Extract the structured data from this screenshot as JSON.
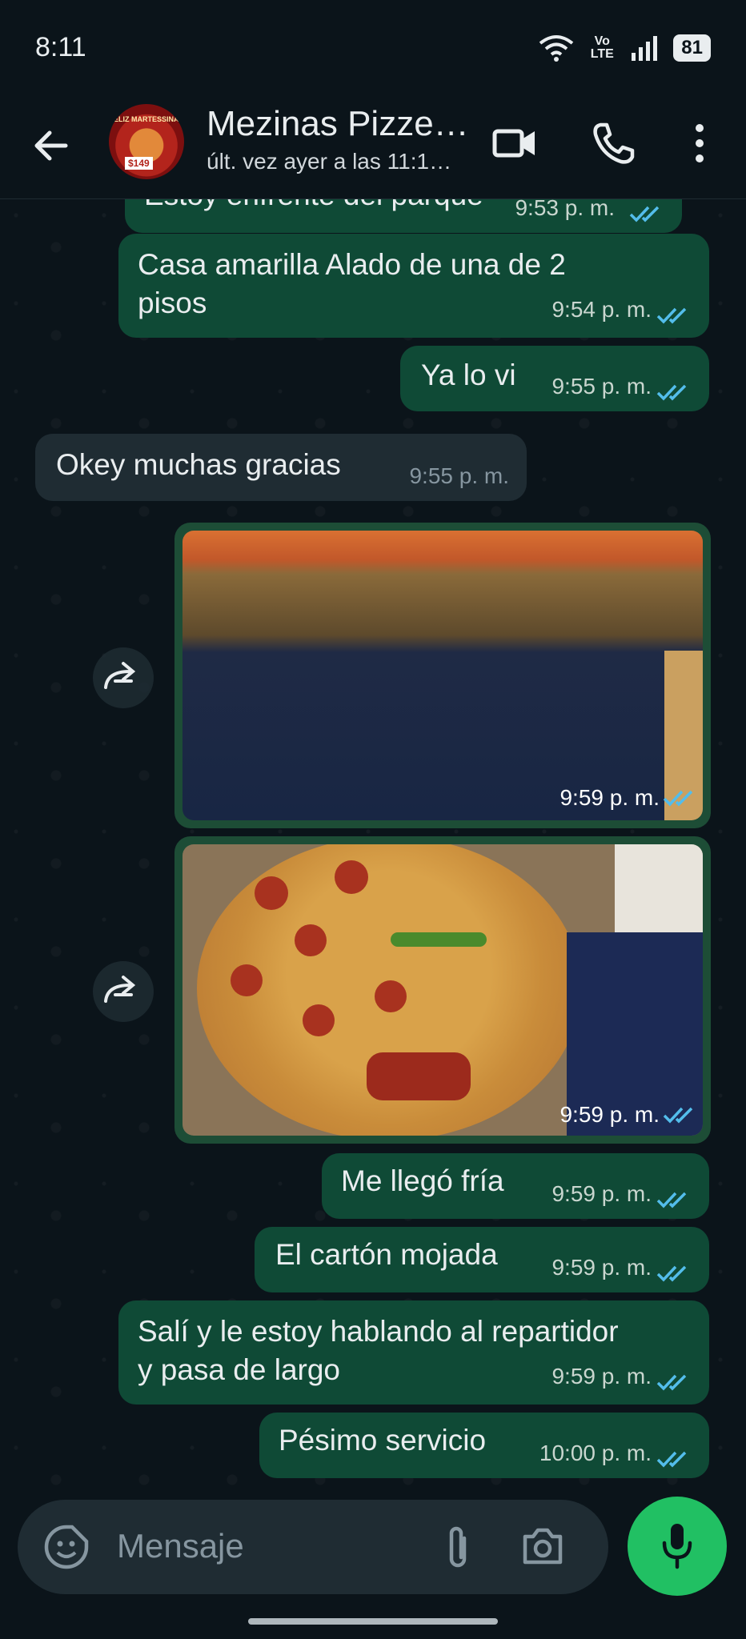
{
  "status_bar": {
    "time": "8:11",
    "network": "Vo LTE",
    "battery": "81"
  },
  "header": {
    "contact_name": "Mezinas Pizze…",
    "last_seen": "últ. vez ayer a las 11:1…",
    "avatar_text": "FELIZ MARTESSINAS",
    "avatar_price": "$149"
  },
  "messages": [
    {
      "text": "Estoy enfrente del parque",
      "time": "9:53 p. m.",
      "dir": "out"
    },
    {
      "text_line1": "Casa amarilla Alado de una de 2",
      "text_line2": "pisos",
      "time": "9:54 p. m.",
      "dir": "out"
    },
    {
      "text": "Ya lo vi",
      "time": "9:55 p. m.",
      "dir": "out"
    },
    {
      "text": "Okey muchas gracias",
      "time": "9:55 p. m.",
      "dir": "in"
    },
    {
      "type": "image",
      "time": "9:59 p. m.",
      "dir": "out"
    },
    {
      "type": "image",
      "time": "9:59 p. m.",
      "dir": "out"
    },
    {
      "text": "Me llegó fría",
      "time": "9:59 p. m.",
      "dir": "out"
    },
    {
      "text": "El cartón mojada",
      "time": "9:59 p. m.",
      "dir": "out"
    },
    {
      "text_line1": "Salí y le estoy hablando al repartidor",
      "text_line2": "y pasa de largo",
      "time": "9:59 p. m.",
      "dir": "out"
    },
    {
      "text": "Pésimo servicio",
      "time": "10:00 p. m.",
      "dir": "out"
    }
  ],
  "input": {
    "placeholder": "Mensaje"
  },
  "colors": {
    "outgoing": "#0f4a36",
    "incoming": "#1f2c33",
    "tick": "#53bdeb",
    "mic": "#21c063"
  }
}
